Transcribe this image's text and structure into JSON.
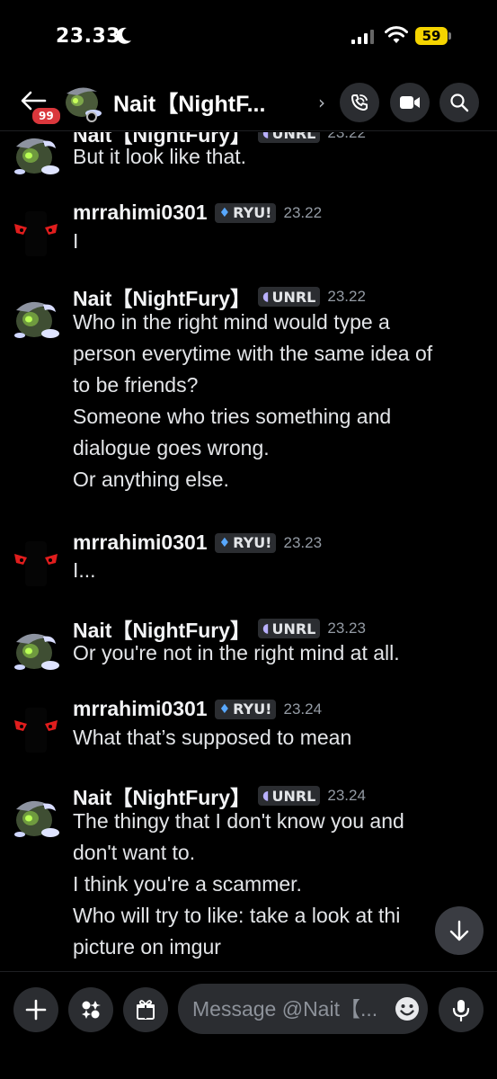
{
  "status": {
    "time": "23.33",
    "battery": "59"
  },
  "header": {
    "title": "Nait【NightF...",
    "unread_count": "99"
  },
  "messages": [
    {
      "user": "Nait【NightFury】",
      "tag": "UNRL",
      "time": "23.22",
      "lines": [
        "But it look like that."
      ]
    },
    {
      "user": "mrrahimi0301",
      "tag": "RYU!",
      "time": "23.22",
      "lines": [
        "I"
      ]
    },
    {
      "user": "Nait【NightFury】",
      "tag": "UNRL",
      "time": "23.22",
      "lines": [
        "Who in the right mind would type a",
        "person everytime with the same idea of",
        "to be friends?",
        "Someone who tries something and",
        "dialogue goes wrong.",
        "Or anything else."
      ]
    },
    {
      "user": "mrrahimi0301",
      "tag": "RYU!",
      "time": "23.23",
      "lines": [
        "I..."
      ]
    },
    {
      "user": "Nait【NightFury】",
      "tag": "UNRL",
      "time": "23.23",
      "lines": [
        "Or you're not in the right mind at all."
      ]
    },
    {
      "user": "mrrahimi0301",
      "tag": "RYU!",
      "time": "23.24",
      "lines": [
        "What that’s supposed to mean"
      ]
    },
    {
      "user": "Nait【NightFury】",
      "tag": "UNRL",
      "time": "23.24",
      "lines": [
        "The thingy that I don't know you and",
        "don't want to.",
        "I think  you're a scammer.",
        "Who will try to like: take a look at thi",
        "picture on imgur"
      ]
    }
  ],
  "composer": {
    "placeholder": "Message @Nait【..."
  },
  "icons": {
    "back": "arrow-left-icon",
    "call": "phone-call-icon",
    "video": "video-camera-icon",
    "search": "search-icon",
    "add": "plus-icon",
    "apps": "apps-icon",
    "gift": "gift-icon",
    "emoji": "emoji-icon",
    "mic": "microphone-icon",
    "scroll": "arrow-down-icon"
  },
  "colors": {
    "background": "#000000",
    "badge": "#da373c",
    "tag_bg": "#2b2d31",
    "timestamp": "#949ba4",
    "battery": "#f5d400"
  }
}
